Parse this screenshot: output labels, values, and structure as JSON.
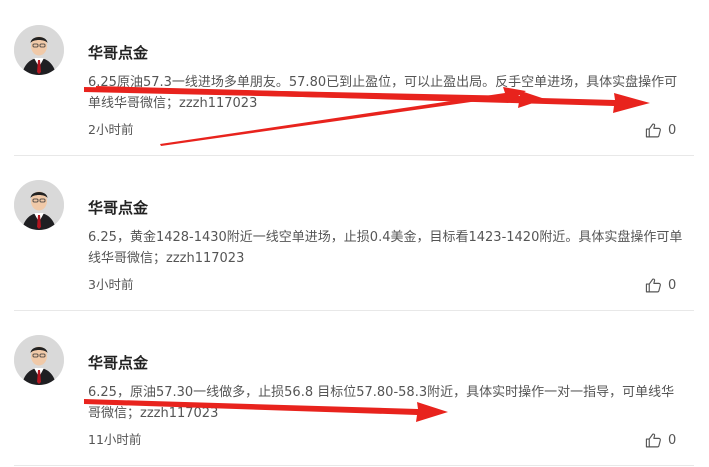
{
  "posts": [
    {
      "author": "华哥点金",
      "content": "6.25原油57.3一线进场多单朋友。57.80已到止盈位，可以止盈出局。反手空单进场，具体实盘操作可单线华哥微信；zzzh117023",
      "time": "2小时前",
      "likes": "0"
    },
    {
      "author": "华哥点金",
      "content": "6.25，黄金1428-1430附近一线空单进场，止损0.4美金，目标看1423-1420附近。具体实盘操作可单线华哥微信；zzzh117023",
      "time": "3小时前",
      "likes": "0"
    },
    {
      "author": "华哥点金",
      "content": "6.25，原油57.30一线做多，止损56.8 目标位57.80-58.3附近，具体实时操作一对一指导，可单线华哥微信；zzzh117023",
      "time": "11小时前",
      "likes": "0"
    }
  ],
  "colors": {
    "annotation": "#e8231d",
    "divider": "#e8e8e8",
    "author": "#222222",
    "text": "#555555"
  },
  "icons": {
    "avatar": "avatar-icon",
    "like": "thumbs-up-icon"
  }
}
